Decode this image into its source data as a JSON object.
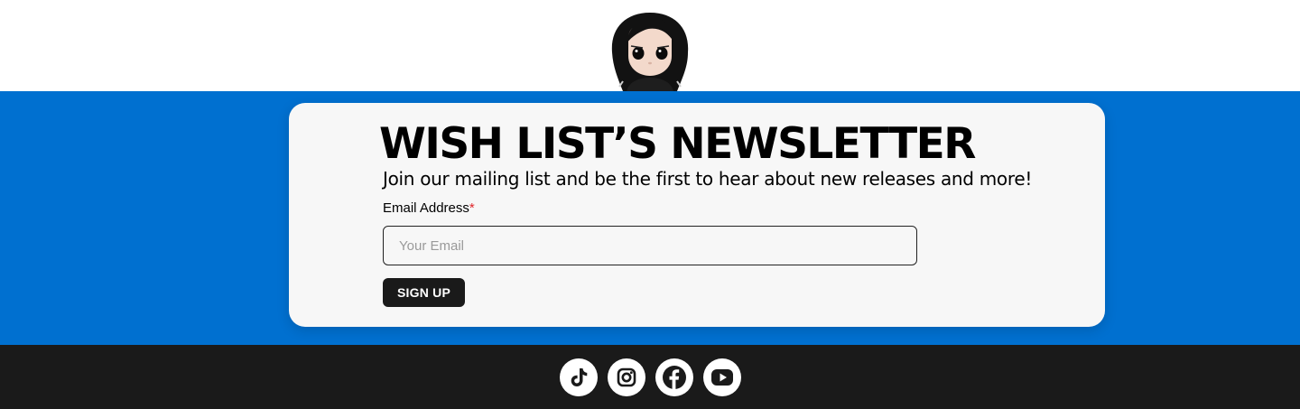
{
  "newsletter": {
    "title": "WISH LIST’S NEWSLETTER",
    "subtitle": "Join our mailing list and be the first to hear about new releases and more!",
    "email_label": "Email Address",
    "required_marker": "*",
    "email_placeholder": "Your Email",
    "email_value": "",
    "signup_label": "SIGN UP"
  },
  "footer": {
    "social_icons": [
      "tiktok-icon",
      "instagram-icon",
      "facebook-icon",
      "youtube-icon"
    ]
  },
  "colors": {
    "band": "#0070d0",
    "card": "#f7f7f7",
    "footer": "#1a1a1a",
    "button": "#1a1a1a",
    "required": "#e0262b"
  }
}
